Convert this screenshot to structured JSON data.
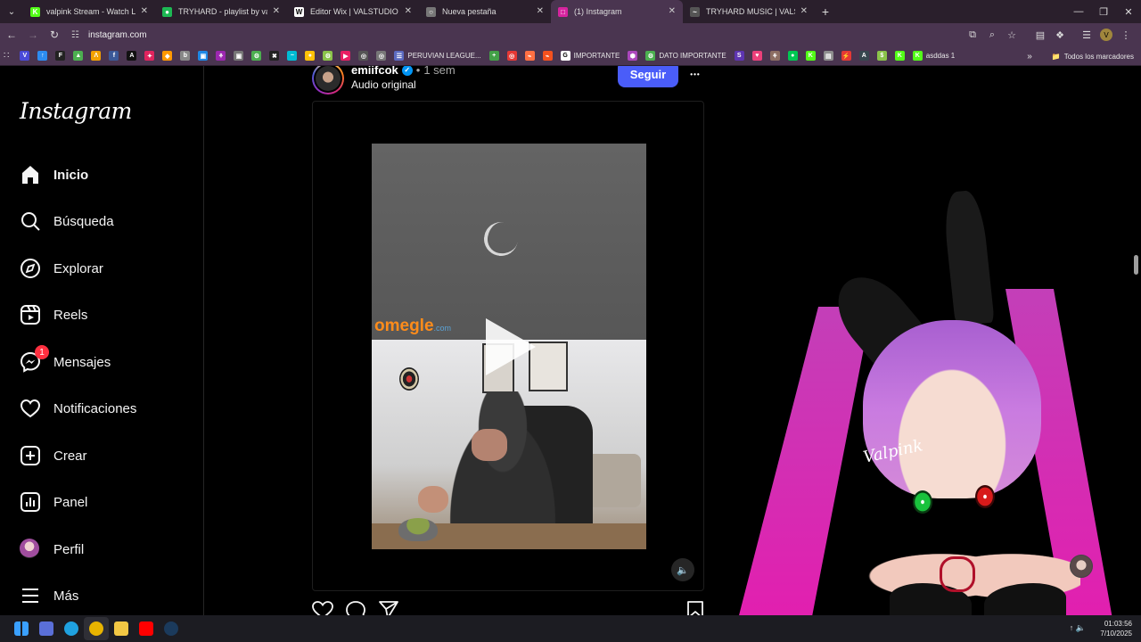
{
  "browser": {
    "tabs": [
      {
        "label": "valpink Stream - Watch Live on",
        "favicon_color": "#53fc18",
        "favicon_glyph": "K"
      },
      {
        "label": "TRYHARD - playlist by valpink |",
        "favicon_color": "#1db954",
        "favicon_glyph": "●"
      },
      {
        "label": "Editor Wix | VALSTUDIO",
        "favicon_color": "#ffffff",
        "favicon_glyph": "W"
      },
      {
        "label": "Nueva pestaña",
        "favicon_color": "#777777",
        "favicon_glyph": "○"
      },
      {
        "label": "(1) Instagram",
        "favicon_color": "#d6249f",
        "favicon_glyph": "□",
        "active": true
      },
      {
        "label": "TRYHARD MUSIC | VALSTUDIO",
        "favicon_color": "#555555",
        "favicon_glyph": "~"
      }
    ],
    "tab_close_glyph": "✕",
    "new_tab_glyph": "+",
    "tab_list_glyph": "⌄",
    "window_controls": {
      "minimize": "—",
      "restore": "❐",
      "close": "✕"
    },
    "nav": {
      "back": "←",
      "forward": "→",
      "reload": "↻"
    },
    "url": "instagram.com",
    "site_info_glyph": "☷",
    "address_right": {
      "install": "⧉",
      "zoom": "⌕",
      "star": "☆",
      "reading": "▤",
      "extensions": "❖",
      "sidepanel": "☰",
      "profile": "V",
      "menu": "⋮"
    },
    "bookmarks": [
      {
        "label": "",
        "color": "#4a4ad8",
        "glyph": "V"
      },
      {
        "label": "",
        "color": "#2d8cf0",
        "glyph": "↑"
      },
      {
        "label": "",
        "color": "#222222",
        "glyph": "F"
      },
      {
        "label": "",
        "color": "#4caf50",
        "glyph": "▲"
      },
      {
        "label": "",
        "color": "#f4a100",
        "glyph": "Λ"
      },
      {
        "label": "",
        "color": "#3b5998",
        "glyph": "f"
      },
      {
        "label": "",
        "color": "#111111",
        "glyph": "A"
      },
      {
        "label": "",
        "color": "#e0245e",
        "glyph": "✦"
      },
      {
        "label": "",
        "color": "#ff9800",
        "glyph": "◆"
      },
      {
        "label": "",
        "color": "#888888",
        "glyph": "b"
      },
      {
        "label": "",
        "color": "#1e88e5",
        "glyph": "▣"
      },
      {
        "label": "",
        "color": "#9c27b0",
        "glyph": "⚘"
      },
      {
        "label": "",
        "color": "#777777",
        "glyph": "▣"
      },
      {
        "label": "",
        "color": "#4caf50",
        "glyph": "⚙"
      },
      {
        "label": "",
        "color": "#222222",
        "glyph": "✖"
      },
      {
        "label": "",
        "color": "#00bcd4",
        "glyph": "~"
      },
      {
        "label": "",
        "color": "#ffc107",
        "glyph": "●"
      },
      {
        "label": "",
        "color": "#8bc34a",
        "glyph": "⚙"
      },
      {
        "label": "",
        "color": "#e91e63",
        "glyph": "▶"
      },
      {
        "label": "",
        "color": "#555555",
        "glyph": "◎"
      },
      {
        "label": "",
        "color": "#777777",
        "glyph": "◎"
      },
      {
        "label": "PERUVIAN LEAGUE...",
        "color": "#5c6bc0",
        "glyph": "☰"
      },
      {
        "label": "",
        "color": "#43a047",
        "glyph": "+"
      },
      {
        "label": "",
        "color": "#e53935",
        "glyph": "◎"
      },
      {
        "label": "",
        "color": "#ff7043",
        "glyph": "⌁"
      },
      {
        "label": "",
        "color": "#f4511e",
        "glyph": "⌁"
      },
      {
        "label": "IMPORTANTE",
        "color": "#ffffff",
        "glyph": "G"
      },
      {
        "label": "",
        "color": "#ab47bc",
        "glyph": "⬢"
      },
      {
        "label": "DATO IMPORTANTE",
        "color": "#4caf50",
        "glyph": "⚙"
      },
      {
        "label": "",
        "color": "#5e35b1",
        "glyph": "S"
      },
      {
        "label": "",
        "color": "#ec407a",
        "glyph": "♥"
      },
      {
        "label": "",
        "color": "#8d6e63",
        "glyph": "⚘"
      },
      {
        "label": "",
        "color": "#00c853",
        "glyph": "●"
      },
      {
        "label": "",
        "color": "#53fc18",
        "glyph": "K"
      },
      {
        "label": "",
        "color": "#8e8e8e",
        "glyph": "▤"
      },
      {
        "label": "",
        "color": "#e53935",
        "glyph": "⚡"
      },
      {
        "label": "",
        "color": "#37474f",
        "glyph": "A"
      },
      {
        "label": "",
        "color": "#8bc34a",
        "glyph": "$"
      },
      {
        "label": "",
        "color": "#53fc18",
        "glyph": "K"
      },
      {
        "label": "asddas 1",
        "color": "#53fc18",
        "glyph": "K"
      }
    ],
    "bookmarks_overflow": "»",
    "all_bookmarks": "Todos los marcadores"
  },
  "instagram": {
    "logo": "Instagram",
    "nav": [
      {
        "key": "inicio",
        "label": "Inicio",
        "icon": "home-icon",
        "active": true
      },
      {
        "key": "busqueda",
        "label": "Búsqueda",
        "icon": "search-icon"
      },
      {
        "key": "explorar",
        "label": "Explorar",
        "icon": "compass-icon"
      },
      {
        "key": "reels",
        "label": "Reels",
        "icon": "reels-icon"
      },
      {
        "key": "mensajes",
        "label": "Mensajes",
        "icon": "messenger-icon",
        "badge": "1"
      },
      {
        "key": "notificaciones",
        "label": "Notificaciones",
        "icon": "heart-icon"
      },
      {
        "key": "crear",
        "label": "Crear",
        "icon": "plus-square-icon"
      },
      {
        "key": "panel",
        "label": "Panel",
        "icon": "dashboard-icon"
      },
      {
        "key": "perfil",
        "label": "Perfil",
        "icon": "avatar"
      },
      {
        "key": "mas",
        "label": "Más",
        "icon": "menu-icon"
      }
    ],
    "post": {
      "username": "emiifcok",
      "separator": "•",
      "time": "1 sem",
      "audio": "Audio original",
      "follow_label": "Seguir",
      "more_glyph": "•••",
      "video_watermark": "omegle",
      "video_watermark_suffix": ".com",
      "sound_glyph": "🔈",
      "verified_glyph": "✓"
    },
    "overlay_signature": "Valpink"
  },
  "taskbar": {
    "items": [
      {
        "name": "windows-start-icon",
        "color": "#3aa0ff"
      },
      {
        "name": "app-icon",
        "color": "#5a6fd8"
      },
      {
        "name": "edge-icon",
        "color": "#1fa1e0"
      },
      {
        "name": "chrome-icon",
        "color": "#e8b400",
        "active": true
      },
      {
        "name": "file-explorer-icon",
        "color": "#f2c744"
      },
      {
        "name": "youtube-icon",
        "color": "#ff0000"
      },
      {
        "name": "steam-icon",
        "color": "#1b3a5c"
      }
    ],
    "tray": "↑ 🔈",
    "time": "01:03:56",
    "date": "7/10/2025"
  }
}
